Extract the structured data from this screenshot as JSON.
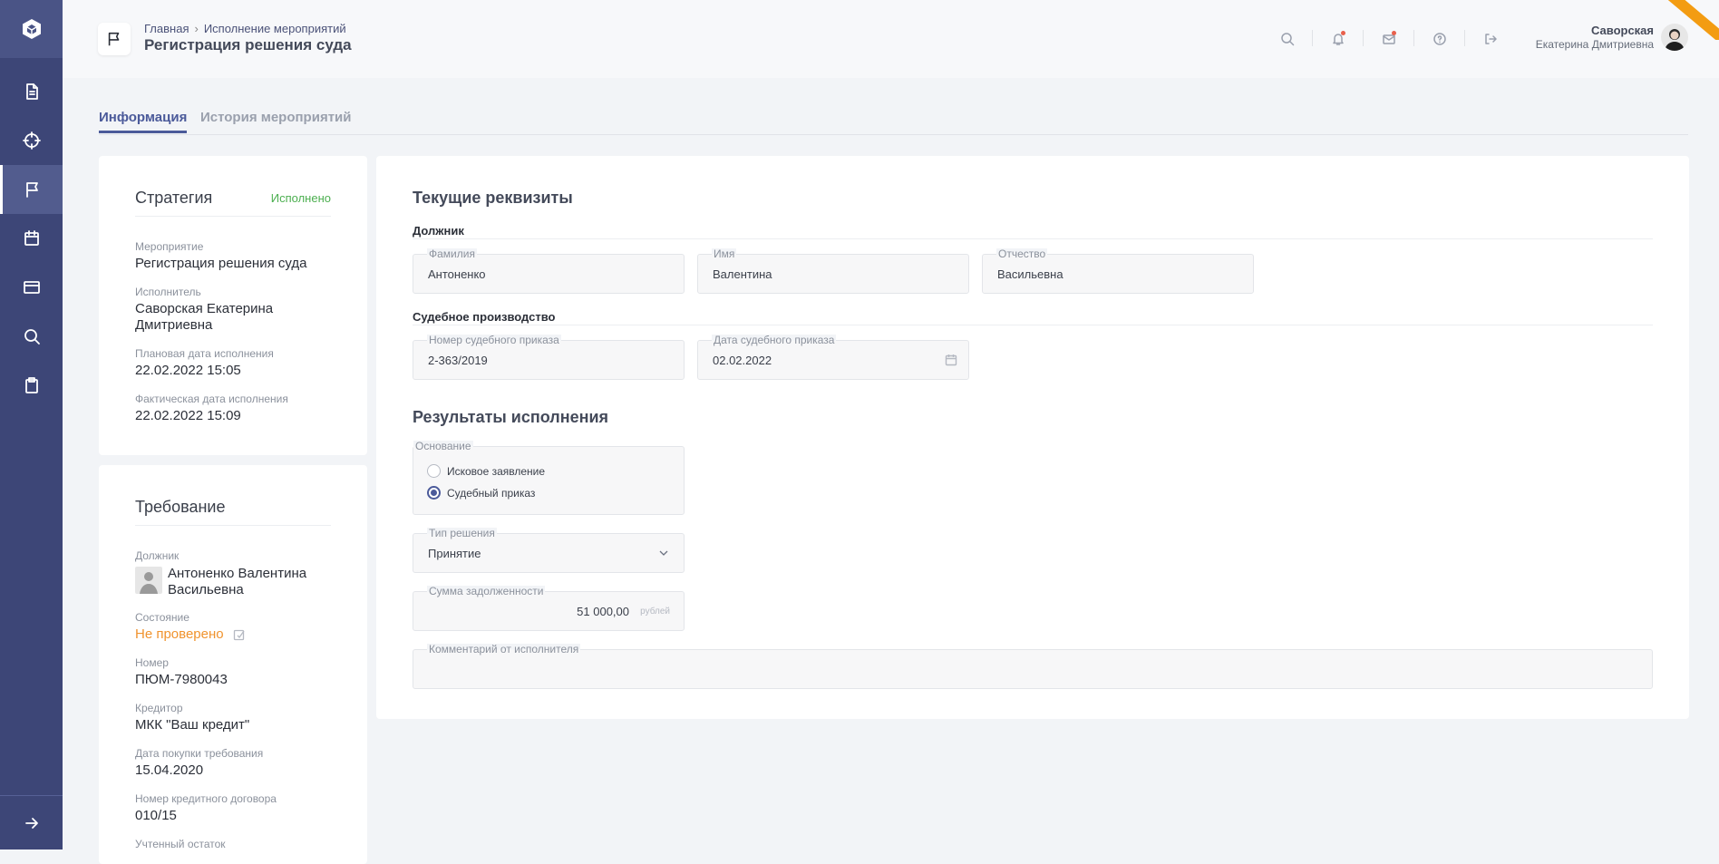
{
  "sidebar": {
    "items": [
      {
        "name": "documents-icon"
      },
      {
        "name": "target-icon"
      },
      {
        "name": "flag-icon",
        "active": true
      },
      {
        "name": "calendar-icon"
      },
      {
        "name": "card-icon"
      },
      {
        "name": "search-icon"
      },
      {
        "name": "clipboard-icon"
      }
    ],
    "expand_icon": "arrow-right-icon"
  },
  "header": {
    "breadcrumb": [
      "Главная",
      "Исполнение мероприятий"
    ],
    "title": "Регистрация решения суда",
    "user_last_name": "Саворская",
    "user_first_names": "Екатерина Дмитриевна"
  },
  "tabs": [
    {
      "label": "Информация",
      "active": true
    },
    {
      "label": "История мероприятий",
      "active": false
    }
  ],
  "strategy_card": {
    "title": "Стратегия",
    "status": "Исполнено",
    "fields": [
      {
        "label": "Мероприятие",
        "value": "Регистрация решения суда"
      },
      {
        "label": "Исполнитель",
        "value": "Саворская Екатерина Дмитриевна"
      },
      {
        "label": "Плановая дата исполнения",
        "value": "22.02.2022 15:05"
      },
      {
        "label": "Фактическая дата исполнения",
        "value": "22.02.2022 15:09"
      }
    ]
  },
  "requirement_card": {
    "title": "Требование",
    "debtor_label": "Должник",
    "debtor_name": "Антоненко Валентина Васильевна",
    "state_label": "Состояние",
    "state_value": "Не проверено",
    "fields": [
      {
        "label": "Номер",
        "value": "ПЮМ-7980043"
      },
      {
        "label": "Кредитор",
        "value": "МКК \"Ваш кредит\""
      },
      {
        "label": "Дата покупки требования",
        "value": "15.04.2020"
      },
      {
        "label": "Номер кредитного договора",
        "value": "010/15"
      },
      {
        "label": "Учтенный остаток",
        "value": ""
      }
    ]
  },
  "form": {
    "current_title": "Текущие реквизиты",
    "debtor_section": "Должник",
    "last_name": {
      "label": "Фамилия",
      "value": "Антоненко"
    },
    "first_name": {
      "label": "Имя",
      "value": "Валентина"
    },
    "patronymic": {
      "label": "Отчество",
      "value": "Васильевна"
    },
    "court_section": "Судебное производство",
    "order_number": {
      "label": "Номер судебного приказа",
      "value": "2-363/2019"
    },
    "order_date": {
      "label": "Дата судебного приказа",
      "value": "02.02.2022"
    },
    "results_title": "Результаты исполнения",
    "basis": {
      "label": "Основание",
      "options": [
        {
          "label": "Исковое заявление",
          "selected": false
        },
        {
          "label": "Судебный приказ",
          "selected": true
        }
      ]
    },
    "decision_type": {
      "label": "Тип решения",
      "value": "Принятие"
    },
    "debt_amount": {
      "label": "Сумма задолженности",
      "value": "51 000,00",
      "unit": "рублей"
    },
    "comment": {
      "label": "Комментарий от исполнителя",
      "value": ""
    }
  },
  "colors": {
    "sidebar": "#3d4677",
    "accent": "#4b5a9a",
    "status_done": "#4caf50",
    "status_unchecked": "#f0932e"
  }
}
